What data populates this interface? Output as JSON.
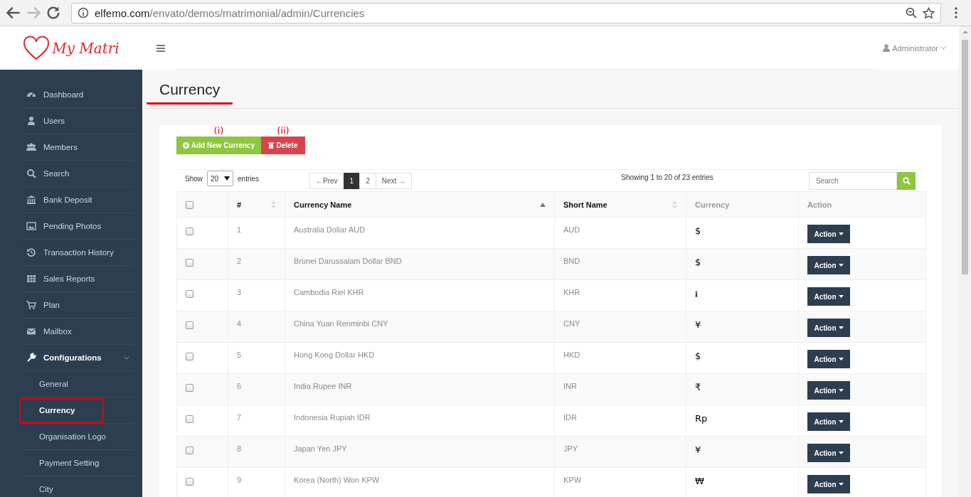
{
  "browser": {
    "url_host": "elfemo.com",
    "url_path": "/envato/demos/matrimonial/admin/Currencies",
    "forward_disabled": true
  },
  "header": {
    "logo": "My Matri",
    "user": "Administrator"
  },
  "sidebar": {
    "items": [
      {
        "label": "Dashboard",
        "expanded": false
      },
      {
        "label": "Users",
        "expanded": false
      },
      {
        "label": "Members",
        "expanded": false
      },
      {
        "label": "Search",
        "expanded": false
      },
      {
        "label": "Bank Deposit",
        "expanded": false
      },
      {
        "label": "Pending Photos",
        "expanded": false
      },
      {
        "label": "Transaction History",
        "expanded": false
      },
      {
        "label": "Sales Reports",
        "expanded": false
      },
      {
        "label": "Plan",
        "expanded": false
      },
      {
        "label": "Mailbox",
        "expanded": false
      },
      {
        "label": "Configurations",
        "expanded": true,
        "children": [
          {
            "label": "General",
            "selected": false
          },
          {
            "label": "Currency",
            "selected": true
          },
          {
            "label": "Organisation Logo",
            "selected": false
          },
          {
            "label": "Payment Setting",
            "selected": false
          },
          {
            "label": "City",
            "selected": false
          }
        ]
      }
    ]
  },
  "page": {
    "title": "Currency"
  },
  "toolbar": {
    "buttons": [
      {
        "kind": "add",
        "label": "Add New Currency",
        "annotation": "(i)"
      },
      {
        "kind": "delete",
        "label": "Delete",
        "annotation": "(ii)"
      }
    ]
  },
  "table_controls": {
    "show_label": "Show",
    "page_size": "20",
    "entries_label": "entries",
    "pagination": [
      {
        "label": "←Prev",
        "selected": false
      },
      {
        "label": "1",
        "selected": true
      },
      {
        "label": "2",
        "selected": false
      },
      {
        "label": "Next →",
        "selected": false
      }
    ],
    "info": "Showing 1 to 20 of 23 entries",
    "search": {
      "placeholder": "Search"
    }
  },
  "table": {
    "columns": [
      {
        "kind": "checkbox",
        "checked": false
      },
      {
        "label": "#",
        "sortable": true,
        "sorted": false
      },
      {
        "label": "Currency Name",
        "sortable": true,
        "sorted": true
      },
      {
        "label": "Short Name",
        "sortable": true,
        "sorted": false
      },
      {
        "label": "Currency",
        "sortable": false
      },
      {
        "label": "Action",
        "sortable": false
      }
    ],
    "rows": [
      {
        "checked": false,
        "number": "1",
        "name": "Australia Dollar AUD",
        "short": "AUD",
        "symbol": "$",
        "action": "Action"
      },
      {
        "checked": false,
        "number": "2",
        "name": "Brunei Darussalam Dollar BND",
        "short": "BND",
        "symbol": "$",
        "action": "Action"
      },
      {
        "checked": false,
        "number": "3",
        "name": "Cambodia Riel KHR",
        "short": "KHR",
        "symbol": "៛",
        "action": "Action"
      },
      {
        "checked": false,
        "number": "4",
        "name": "China Yuan Renminbi CNY",
        "short": "CNY",
        "symbol": "¥",
        "action": "Action"
      },
      {
        "checked": false,
        "number": "5",
        "name": "Hong Kong Dollar HKD",
        "short": "HKD",
        "symbol": "$",
        "action": "Action"
      },
      {
        "checked": false,
        "number": "6",
        "name": "India Rupee INR",
        "short": "INR",
        "symbol": "₹",
        "action": "Action"
      },
      {
        "checked": false,
        "number": "7",
        "name": "Indonesia Rupiah IDR",
        "short": "IDR",
        "symbol": "Rp",
        "action": "Action"
      },
      {
        "checked": false,
        "number": "8",
        "name": "Japan Yen JPY",
        "short": "JPY",
        "symbol": "¥",
        "action": "Action"
      },
      {
        "checked": false,
        "number": "9",
        "name": "Korea (North) Won KPW",
        "short": "KPW",
        "symbol": "₩",
        "action": "Action"
      }
    ]
  }
}
